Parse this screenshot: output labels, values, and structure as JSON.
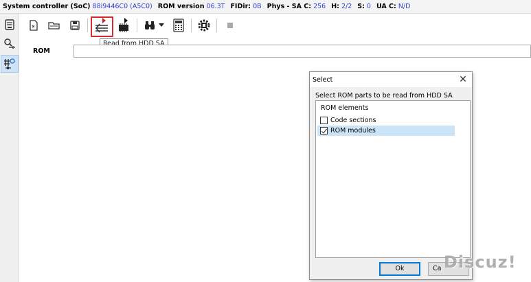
{
  "status_bar": {
    "soc_label": "System controller (SoC)",
    "soc_value": "88i9446C0 (A5C0)",
    "rom_version_label": "ROM version",
    "rom_version_value": "06.3Т",
    "fidir_label": "FIDir:",
    "fidir_value": "0В",
    "phys_label": "Phys - SA C:",
    "phys_value": "256",
    "h_label": "H:",
    "h_value": "2/2",
    "s_label": "S:",
    "s_value": "0",
    "ua_label": "UA C:",
    "ua_value": "N/D"
  },
  "toolbar": {
    "tooltip": "Read from HDD SA",
    "icons": [
      "open-file-icon",
      "open-folder-icon",
      "save-icon",
      "read-from-hdd-sa-icon",
      "write-chip-icon",
      "binoculars-icon",
      "dropdown-arrow-icon",
      "calculator-icon",
      "chip-gear-icon",
      "stop-icon"
    ]
  },
  "sidebar": {
    "icons": [
      "device-icon",
      "search-key-icon",
      "network-tool-icon"
    ]
  },
  "rom_field": {
    "label": "ROM",
    "value": ""
  },
  "dialog": {
    "title": "Select",
    "prompt": "Select ROM parts to be read from HDD SA",
    "list_header": "ROM elements",
    "items": [
      {
        "label": "Code sections",
        "checked": false
      },
      {
        "label": "ROM modules",
        "checked": true
      }
    ],
    "ok_label": "Ok",
    "cancel_label": "Ca"
  },
  "watermark": "Discuz!"
}
